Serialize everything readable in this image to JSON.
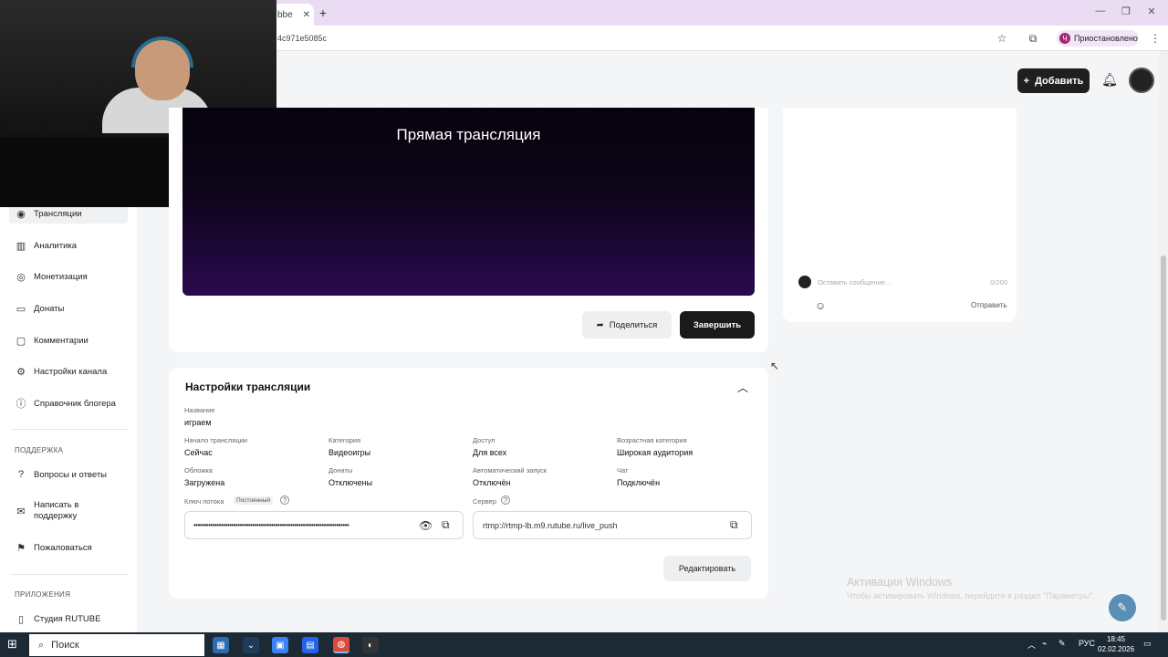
{
  "browser": {
    "tab_title": "bbe",
    "url": "4c971e5085c",
    "profile_initial": "Ч",
    "profile_label": "Приостановлено"
  },
  "header": {
    "add_label": "Добавить"
  },
  "sidebar": {
    "items": [
      {
        "label": "Трансляции",
        "icon": "broadcast-icon"
      },
      {
        "label": "Аналитика",
        "icon": "chart-icon"
      },
      {
        "label": "Монетизация",
        "icon": "coins-icon"
      },
      {
        "label": "Донаты",
        "icon": "gift-icon"
      },
      {
        "label": "Комментарии",
        "icon": "comment-icon"
      },
      {
        "label": "Настройки канала",
        "icon": "gear-icon"
      },
      {
        "label": "Справочник блогера",
        "icon": "info-icon"
      }
    ],
    "support_heading": "ПОДДЕРЖКА",
    "support_items": [
      {
        "label": "Вопросы и ответы",
        "icon": "help-circle-icon"
      },
      {
        "label": "Написать в поддержку",
        "icon": "mail-icon"
      },
      {
        "label": "Пожаловаться",
        "icon": "flag-icon"
      }
    ],
    "apps_heading": "ПРИЛОЖЕНИЯ",
    "apps_items": [
      {
        "label": "Студия RUTUBE",
        "icon": "phone-icon"
      }
    ]
  },
  "player": {
    "title": "Прямая трансляция",
    "share_label": "Поделиться",
    "end_label": "Завершить"
  },
  "chat": {
    "placeholder": "Оставить сообщение...",
    "counter": "0/200",
    "send_label": "Отправить"
  },
  "settings": {
    "title": "Настройки трансляции",
    "name_label": "Название",
    "name_value": "играем",
    "fields": [
      {
        "label": "Начало трансляции",
        "value": "Сейчас"
      },
      {
        "label": "Категория",
        "value": "Видеоигры"
      },
      {
        "label": "Доступ",
        "value": "Для всех"
      },
      {
        "label": "Возрастная категория",
        "value": "Широкая аудитория"
      },
      {
        "label": "Обложка",
        "value": "Загружена"
      },
      {
        "label": "Донаты",
        "value": "Отключены"
      },
      {
        "label": "Автоматический запуск",
        "value": "Отключён"
      },
      {
        "label": "Чат",
        "value": "Подключён"
      }
    ],
    "key_label": "Ключ потока",
    "key_badge": "Постоянный",
    "key_mask": "••••••••••••••••••••••••••••••••••••••••••••••••••••••••••••••••••••••••••",
    "server_label": "Сервер",
    "server_value": "rtmp://rtmp-lb.m9.rutube.ru/live_push",
    "edit_label": "Редактировать"
  },
  "watermark": {
    "line1": "Активация Windows",
    "line2": "Чтобы активировать Windows, перейдите в раздел \"Параметры\"."
  },
  "taskbar": {
    "search_label": "Поиск",
    "lang": "РУС",
    "time": "18:45",
    "date": "02.02.2026"
  }
}
